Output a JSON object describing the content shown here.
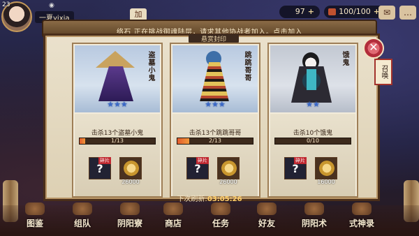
{
  "hud": {
    "level": "23",
    "player_name": "一夏yixia",
    "add_chip": "加",
    "coins": "97",
    "tickets": "100/100",
    "mail_icon": "mail-icon",
    "chat_icon": "chat-icon"
  },
  "banner": {
    "text": "络石 正在挑战御魂陆层，请求其他协战者加入。点击加入"
  },
  "panel": {
    "title": "悬赏封印"
  },
  "cards": [
    {
      "name": "盗墓小鬼",
      "stars": "★★★",
      "task": "击杀13个盗墓小鬼",
      "progress_text": "1/13",
      "progress": 0.077,
      "fragment_tag": "碎片",
      "fragment_mark": "?",
      "coin_count": "26000"
    },
    {
      "name": "跳跳哥哥",
      "stars": "★★★",
      "task": "击杀13个跳跳哥哥",
      "progress_text": "2/13",
      "progress": 0.154,
      "fragment_tag": "碎片",
      "fragment_mark": "?",
      "coin_count": "26000"
    },
    {
      "name": "饿鬼",
      "stars": "★★",
      "task": "击杀10个饿鬼",
      "progress_text": "0/10",
      "progress": 0.0,
      "fragment_tag": "碎片",
      "fragment_mark": "?",
      "coin_count": "16000"
    }
  ],
  "refresh": {
    "label": "下次刷新:",
    "timer": "03:05:26"
  },
  "summon": "召唤",
  "nav": [
    "图鉴",
    "组队",
    "阴阳寮",
    "商店",
    "任务",
    "好友",
    "阴阳术",
    "式神录"
  ],
  "colors": {
    "panel_bg": "#eae1cc",
    "progress": "#e35b2d",
    "close": "#b22d3b"
  }
}
